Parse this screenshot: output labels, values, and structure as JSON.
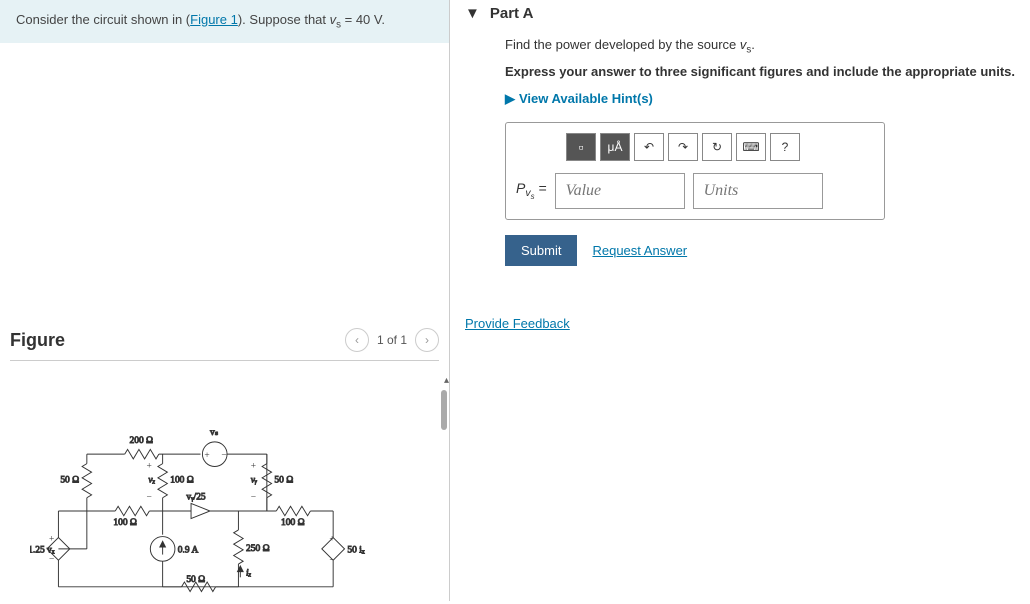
{
  "problem": {
    "prefix": "Consider the circuit shown in (",
    "figure_link": "Figure 1",
    "suffix": "). Suppose that ",
    "var": "v",
    "sub": "s",
    "value": " = 40 V."
  },
  "figure": {
    "title": "Figure",
    "nav_text": "1 of 1"
  },
  "circuit": {
    "r200": "200 Ω",
    "r50a": "50 Ω",
    "r100a": "100 Ω",
    "r50b": "50 Ω",
    "r100b": "100 Ω",
    "r100c": "100 Ω",
    "r250": "250 Ω",
    "r50c": "50 Ω",
    "vs": "vₛ",
    "vx": "vₓ",
    "vy": "vᵧ",
    "vy25": "vᵧ/25",
    "src_left": "1.25 vₓ",
    "i09": "0.9 A",
    "ix": "iₓ",
    "src_right": "50 iₓ"
  },
  "part": {
    "label": "Part A",
    "question_prefix": "Find the power developed by the source ",
    "question_var": "v",
    "question_sub": "s",
    "question_suffix": ".",
    "instruction": "Express your answer to three significant figures and include the appropriate units.",
    "hints": "View Available Hint(s)"
  },
  "toolbar": {
    "fraction": "□",
    "units": "μÅ",
    "undo": "↶",
    "redo": "↷",
    "reset": "↻",
    "keyboard": "⌨",
    "help": "?"
  },
  "answer": {
    "var_label_p": "P",
    "var_label_v": "v",
    "var_label_sub": "s",
    "equals": " = ",
    "value_placeholder": "Value",
    "units_placeholder": "Units"
  },
  "actions": {
    "submit": "Submit",
    "request": "Request Answer",
    "feedback": "Provide Feedback"
  }
}
